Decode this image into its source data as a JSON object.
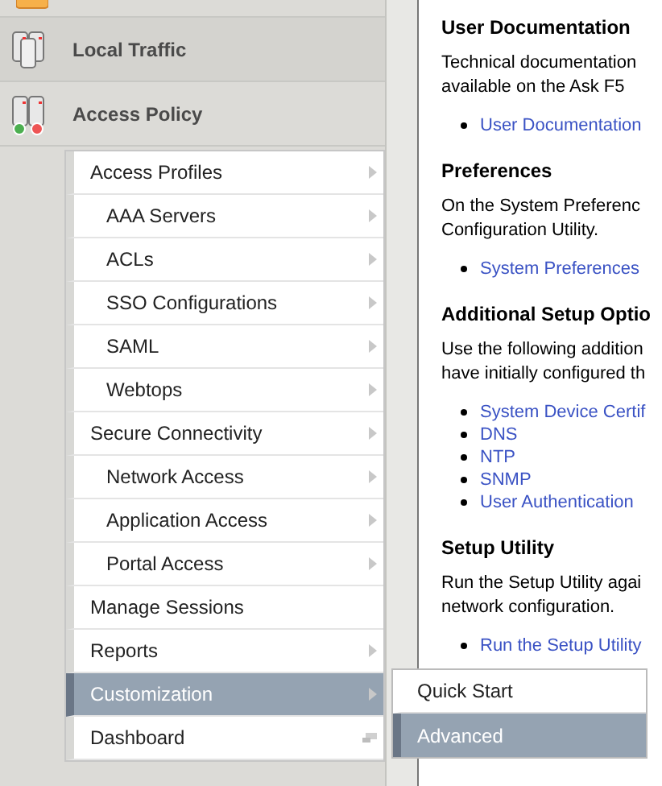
{
  "nav_sections": [
    {
      "label": "Local Traffic",
      "kind": "plain"
    },
    {
      "label": "Access Policy",
      "kind": "status"
    }
  ],
  "menu": [
    {
      "label": "Access Profiles",
      "kind": "submenu",
      "selected": false,
      "children": [
        {
          "label": "AAA Servers",
          "kind": "submenu",
          "selected": false
        },
        {
          "label": "ACLs",
          "kind": "submenu",
          "selected": false
        },
        {
          "label": "SSO Configurations",
          "kind": "submenu",
          "selected": false
        },
        {
          "label": "SAML",
          "kind": "submenu",
          "selected": false
        },
        {
          "label": "Webtops",
          "kind": "submenu",
          "selected": false
        }
      ]
    },
    {
      "label": "Secure Connectivity",
      "kind": "submenu",
      "selected": false,
      "children": [
        {
          "label": "Network Access",
          "kind": "submenu",
          "selected": false
        },
        {
          "label": "Application Access",
          "kind": "submenu",
          "selected": false
        },
        {
          "label": "Portal Access",
          "kind": "submenu",
          "selected": false
        }
      ]
    },
    {
      "label": "Manage Sessions",
      "kind": "link",
      "selected": false
    },
    {
      "label": "Reports",
      "kind": "submenu",
      "selected": false
    },
    {
      "label": "Customization",
      "kind": "submenu",
      "selected": true
    },
    {
      "label": "Dashboard",
      "kind": "window",
      "selected": false
    }
  ],
  "submenu": [
    {
      "label": "Quick Start",
      "selected": false
    },
    {
      "label": "Advanced",
      "selected": true
    }
  ],
  "content": [
    {
      "heading": "User Documentation",
      "paragraph": [
        "Technical documentation",
        "available on the Ask F5"
      ],
      "links": [
        "User Documentation"
      ]
    },
    {
      "heading": "Preferences",
      "paragraph": [
        "On the System Preferenc",
        "Configuration Utility."
      ],
      "links": [
        "System Preferences"
      ]
    },
    {
      "heading": "Additional Setup Optio",
      "paragraph": [
        "Use the following addition",
        "have initially configured th"
      ],
      "links": [
        "System Device Certif",
        "DNS",
        "NTP",
        "SNMP",
        "User Authentication"
      ]
    },
    {
      "heading": "Setup Utility",
      "paragraph": [
        "Run the Setup Utility agai",
        "network configuration."
      ],
      "links": [
        "Run the Setup Utility"
      ]
    }
  ]
}
